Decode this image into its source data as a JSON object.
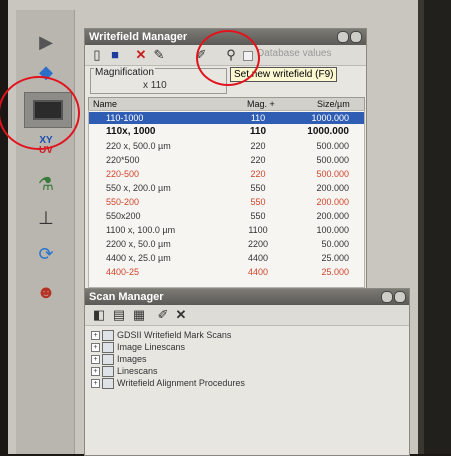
{
  "writefield": {
    "title": "Writefield Manager",
    "checkbox_label": "Database values",
    "tooltip": "Set new writefield (F9)",
    "magnification_label": "Magnification",
    "magnification_value": "x 110",
    "columns": {
      "name": "Name",
      "mag": "Mag. +",
      "size": "Size/µm"
    },
    "rows": [
      {
        "name": "110-1000",
        "mag": "110",
        "size": "1000.000",
        "style": "hl"
      },
      {
        "name": "110x, 1000",
        "mag": "110",
        "size": "1000.000",
        "style": "bold"
      },
      {
        "name": "220 x, 500.0 µm",
        "mag": "220",
        "size": "500.000",
        "style": ""
      },
      {
        "name": "220*500",
        "mag": "220",
        "size": "500.000",
        "style": ""
      },
      {
        "name": "220-500",
        "mag": "220",
        "size": "500.000",
        "style": "red"
      },
      {
        "name": "550 x, 200.0 µm",
        "mag": "550",
        "size": "200.000",
        "style": ""
      },
      {
        "name": "550-200",
        "mag": "550",
        "size": "200.000",
        "style": "red"
      },
      {
        "name": "550x200",
        "mag": "550",
        "size": "200.000",
        "style": ""
      },
      {
        "name": "1100 x, 100.0 µm",
        "mag": "1100",
        "size": "100.000",
        "style": ""
      },
      {
        "name": "2200 x, 50.0 µm",
        "mag": "2200",
        "size": "50.000",
        "style": ""
      },
      {
        "name": "4400 x, 25.0 µm",
        "mag": "4400",
        "size": "25.000",
        "style": ""
      },
      {
        "name": "4400-25",
        "mag": "4400",
        "size": "25.000",
        "style": "red"
      }
    ]
  },
  "scan_manager": {
    "title": "Scan Manager",
    "items": [
      {
        "label": "GDSII Writefield Mark Scans",
        "icon": "grid-icon"
      },
      {
        "label": "Image Linescans",
        "icon": "image-icon"
      },
      {
        "label": "Images",
        "icon": "image-icon"
      },
      {
        "label": "Linescans",
        "icon": "line-icon"
      },
      {
        "label": "Writefield Alignment Procedures",
        "icon": "grid-icon"
      }
    ]
  },
  "left_tools": [
    {
      "name": "play-icon",
      "glyph": "▶"
    },
    {
      "name": "stage-icon",
      "glyph": "◆"
    },
    {
      "name": "monitor-icon",
      "glyph": "▬"
    },
    {
      "name": "xy-uv-icon",
      "glyph": "XY"
    },
    {
      "name": "pattern-icon",
      "glyph": "⚗"
    },
    {
      "name": "microscope-icon",
      "glyph": "⊥"
    },
    {
      "name": "globe-icon",
      "glyph": "⟳"
    },
    {
      "name": "user-icon",
      "glyph": "☻"
    }
  ],
  "tool_text": {
    "xy": "XY",
    "uv": "UV"
  },
  "colors": {
    "annotation": "#e1141e",
    "highlight": "#2f5db3",
    "red_row": "#d0442c"
  }
}
